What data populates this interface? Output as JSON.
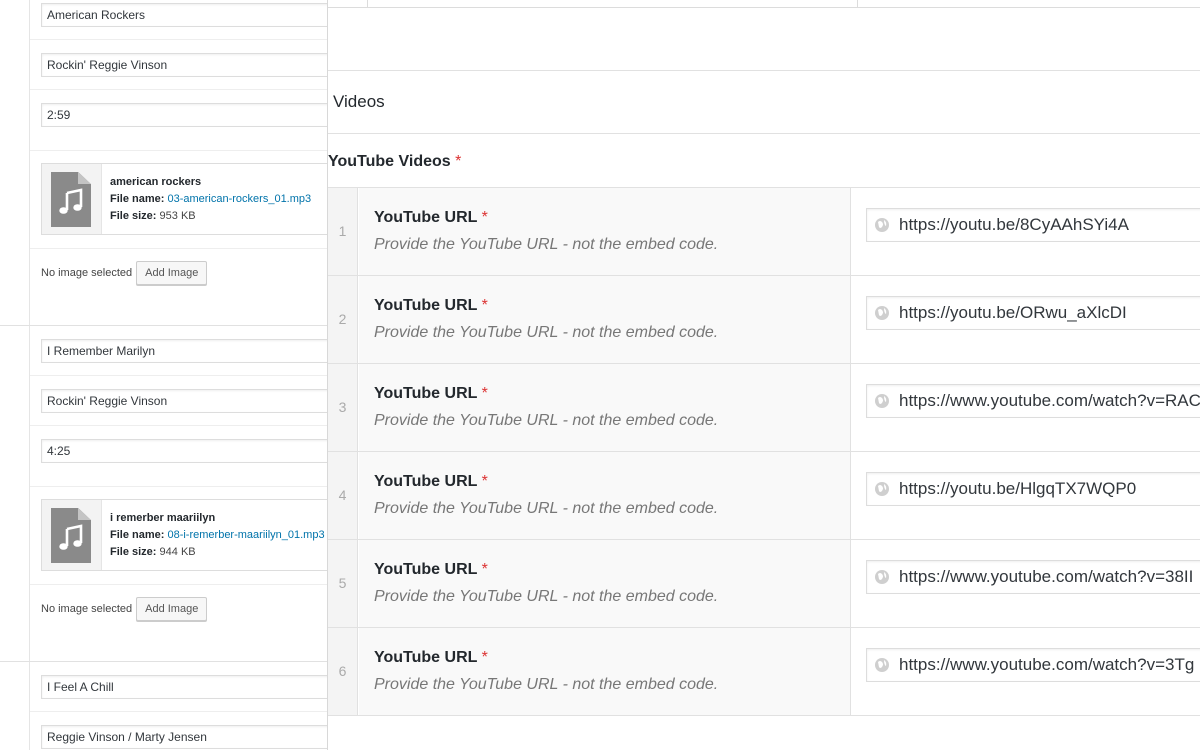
{
  "left_panel": {
    "songs": [
      {
        "title": "American Rockers",
        "artist": "Rockin' Reggie Vinson",
        "duration": "2:59",
        "file": {
          "title": "american rockers",
          "name_label": "File name:",
          "name": "03-american-rockers_01.mp3",
          "size_label": "File size:",
          "size": "953 KB"
        },
        "image": {
          "status": "No image selected",
          "button": "Add Image"
        }
      },
      {
        "title": "I Remember Marilyn",
        "artist": "Rockin' Reggie Vinson",
        "duration": "4:25",
        "file": {
          "title": "i remerber maariilyn",
          "name_label": "File name:",
          "name": "08-i-remerber-maariilyn_01.mp3",
          "size_label": "File size:",
          "size": "944 KB"
        },
        "image": {
          "status": "No image selected",
          "button": "Add Image"
        }
      },
      {
        "title": "I Feel A Chill",
        "artist": "Reggie Vinson / Marty Jensen"
      }
    ],
    "file_icon": "audio-file-icon"
  },
  "right_panel": {
    "section_title": "Videos",
    "field_label": "YouTube Videos",
    "required_mark": "*",
    "rows": [
      {
        "index": "1",
        "label": "YouTube URL",
        "required": "*",
        "hint": "Provide the YouTube URL - not the embed code.",
        "value": "https://youtu.be/8CyAAhSYi4A"
      },
      {
        "index": "2",
        "label": "YouTube URL",
        "required": "*",
        "hint": "Provide the YouTube URL - not the embed code.",
        "value": "https://youtu.be/ORwu_aXlcDI"
      },
      {
        "index": "3",
        "label": "YouTube URL",
        "required": "*",
        "hint": "Provide the YouTube URL - not the embed code.",
        "value": "https://www.youtube.com/watch?v=RAC"
      },
      {
        "index": "4",
        "label": "YouTube URL",
        "required": "*",
        "hint": "Provide the YouTube URL - not the embed code.",
        "value": "https://youtu.be/HlgqTX7WQP0"
      },
      {
        "index": "5",
        "label": "YouTube URL",
        "required": "*",
        "hint": "Provide the YouTube URL - not the embed code.",
        "value": "https://www.youtube.com/watch?v=38II"
      },
      {
        "index": "6",
        "label": "YouTube URL",
        "required": "*",
        "hint": "Provide the YouTube URL - not the embed code.",
        "value": "https://www.youtube.com/watch?v=3Tg"
      }
    ],
    "url_icon": "globe-icon"
  },
  "colors": {
    "required": "#dc3232",
    "link": "#0073aa",
    "hint": "#777777",
    "label_bg": "#f9f9f9",
    "index_bg": "#f4f4f4"
  }
}
